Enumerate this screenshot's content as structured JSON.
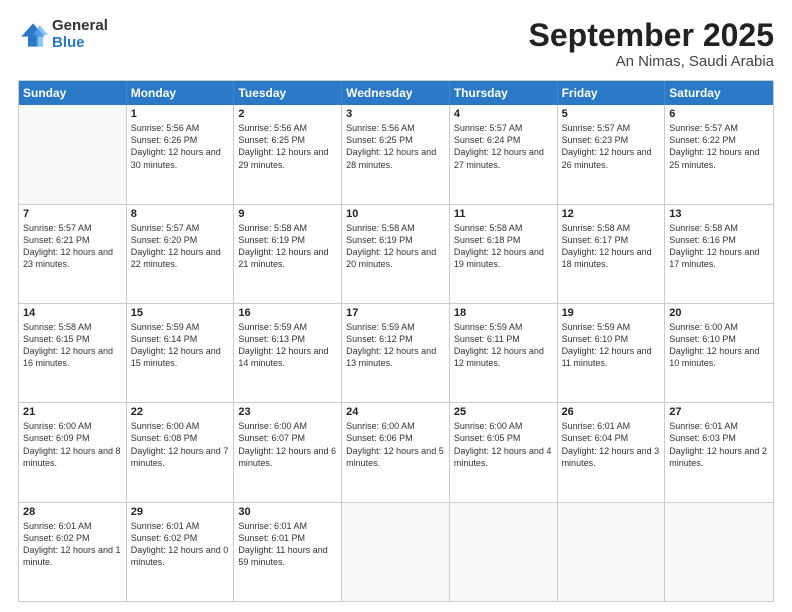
{
  "header": {
    "logo": {
      "general": "General",
      "blue": "Blue"
    },
    "month": "September 2025",
    "location": "An Nimas, Saudi Arabia"
  },
  "weekdays": [
    "Sunday",
    "Monday",
    "Tuesday",
    "Wednesday",
    "Thursday",
    "Friday",
    "Saturday"
  ],
  "rows": [
    [
      {
        "day": "",
        "empty": true
      },
      {
        "day": "1",
        "sunrise": "Sunrise: 5:56 AM",
        "sunset": "Sunset: 6:26 PM",
        "daylight": "Daylight: 12 hours and 30 minutes."
      },
      {
        "day": "2",
        "sunrise": "Sunrise: 5:56 AM",
        "sunset": "Sunset: 6:25 PM",
        "daylight": "Daylight: 12 hours and 29 minutes."
      },
      {
        "day": "3",
        "sunrise": "Sunrise: 5:56 AM",
        "sunset": "Sunset: 6:25 PM",
        "daylight": "Daylight: 12 hours and 28 minutes."
      },
      {
        "day": "4",
        "sunrise": "Sunrise: 5:57 AM",
        "sunset": "Sunset: 6:24 PM",
        "daylight": "Daylight: 12 hours and 27 minutes."
      },
      {
        "day": "5",
        "sunrise": "Sunrise: 5:57 AM",
        "sunset": "Sunset: 6:23 PM",
        "daylight": "Daylight: 12 hours and 26 minutes."
      },
      {
        "day": "6",
        "sunrise": "Sunrise: 5:57 AM",
        "sunset": "Sunset: 6:22 PM",
        "daylight": "Daylight: 12 hours and 25 minutes."
      }
    ],
    [
      {
        "day": "7",
        "sunrise": "Sunrise: 5:57 AM",
        "sunset": "Sunset: 6:21 PM",
        "daylight": "Daylight: 12 hours and 23 minutes."
      },
      {
        "day": "8",
        "sunrise": "Sunrise: 5:57 AM",
        "sunset": "Sunset: 6:20 PM",
        "daylight": "Daylight: 12 hours and 22 minutes."
      },
      {
        "day": "9",
        "sunrise": "Sunrise: 5:58 AM",
        "sunset": "Sunset: 6:19 PM",
        "daylight": "Daylight: 12 hours and 21 minutes."
      },
      {
        "day": "10",
        "sunrise": "Sunrise: 5:58 AM",
        "sunset": "Sunset: 6:19 PM",
        "daylight": "Daylight: 12 hours and 20 minutes."
      },
      {
        "day": "11",
        "sunrise": "Sunrise: 5:58 AM",
        "sunset": "Sunset: 6:18 PM",
        "daylight": "Daylight: 12 hours and 19 minutes."
      },
      {
        "day": "12",
        "sunrise": "Sunrise: 5:58 AM",
        "sunset": "Sunset: 6:17 PM",
        "daylight": "Daylight: 12 hours and 18 minutes."
      },
      {
        "day": "13",
        "sunrise": "Sunrise: 5:58 AM",
        "sunset": "Sunset: 6:16 PM",
        "daylight": "Daylight: 12 hours and 17 minutes."
      }
    ],
    [
      {
        "day": "14",
        "sunrise": "Sunrise: 5:58 AM",
        "sunset": "Sunset: 6:15 PM",
        "daylight": "Daylight: 12 hours and 16 minutes."
      },
      {
        "day": "15",
        "sunrise": "Sunrise: 5:59 AM",
        "sunset": "Sunset: 6:14 PM",
        "daylight": "Daylight: 12 hours and 15 minutes."
      },
      {
        "day": "16",
        "sunrise": "Sunrise: 5:59 AM",
        "sunset": "Sunset: 6:13 PM",
        "daylight": "Daylight: 12 hours and 14 minutes."
      },
      {
        "day": "17",
        "sunrise": "Sunrise: 5:59 AM",
        "sunset": "Sunset: 6:12 PM",
        "daylight": "Daylight: 12 hours and 13 minutes."
      },
      {
        "day": "18",
        "sunrise": "Sunrise: 5:59 AM",
        "sunset": "Sunset: 6:11 PM",
        "daylight": "Daylight: 12 hours and 12 minutes."
      },
      {
        "day": "19",
        "sunrise": "Sunrise: 5:59 AM",
        "sunset": "Sunset: 6:10 PM",
        "daylight": "Daylight: 12 hours and 11 minutes."
      },
      {
        "day": "20",
        "sunrise": "Sunrise: 6:00 AM",
        "sunset": "Sunset: 6:10 PM",
        "daylight": "Daylight: 12 hours and 10 minutes."
      }
    ],
    [
      {
        "day": "21",
        "sunrise": "Sunrise: 6:00 AM",
        "sunset": "Sunset: 6:09 PM",
        "daylight": "Daylight: 12 hours and 8 minutes."
      },
      {
        "day": "22",
        "sunrise": "Sunrise: 6:00 AM",
        "sunset": "Sunset: 6:08 PM",
        "daylight": "Daylight: 12 hours and 7 minutes."
      },
      {
        "day": "23",
        "sunrise": "Sunrise: 6:00 AM",
        "sunset": "Sunset: 6:07 PM",
        "daylight": "Daylight: 12 hours and 6 minutes."
      },
      {
        "day": "24",
        "sunrise": "Sunrise: 6:00 AM",
        "sunset": "Sunset: 6:06 PM",
        "daylight": "Daylight: 12 hours and 5 minutes."
      },
      {
        "day": "25",
        "sunrise": "Sunrise: 6:00 AM",
        "sunset": "Sunset: 6:05 PM",
        "daylight": "Daylight: 12 hours and 4 minutes."
      },
      {
        "day": "26",
        "sunrise": "Sunrise: 6:01 AM",
        "sunset": "Sunset: 6:04 PM",
        "daylight": "Daylight: 12 hours and 3 minutes."
      },
      {
        "day": "27",
        "sunrise": "Sunrise: 6:01 AM",
        "sunset": "Sunset: 6:03 PM",
        "daylight": "Daylight: 12 hours and 2 minutes."
      }
    ],
    [
      {
        "day": "28",
        "sunrise": "Sunrise: 6:01 AM",
        "sunset": "Sunset: 6:02 PM",
        "daylight": "Daylight: 12 hours and 1 minute."
      },
      {
        "day": "29",
        "sunrise": "Sunrise: 6:01 AM",
        "sunset": "Sunset: 6:02 PM",
        "daylight": "Daylight: 12 hours and 0 minutes."
      },
      {
        "day": "30",
        "sunrise": "Sunrise: 6:01 AM",
        "sunset": "Sunset: 6:01 PM",
        "daylight": "Daylight: 11 hours and 59 minutes."
      },
      {
        "day": "",
        "empty": true
      },
      {
        "day": "",
        "empty": true
      },
      {
        "day": "",
        "empty": true
      },
      {
        "day": "",
        "empty": true
      }
    ]
  ]
}
